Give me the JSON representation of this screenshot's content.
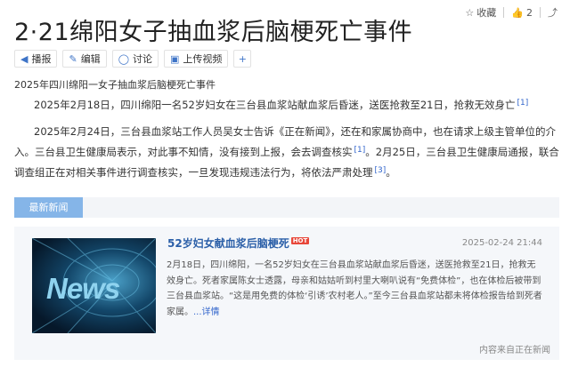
{
  "title": "2·21绵阳女子抽血浆后脑梗死亡事件",
  "top_actions": {
    "favorite_label": "收藏",
    "like_count": "2"
  },
  "toolbar": {
    "play_label": "播报",
    "edit_label": "编辑",
    "discuss_label": "讨论",
    "upload_video_label": "上传视频",
    "add_label": "+"
  },
  "summary": "2025年四川绵阳一女子抽血浆后脑梗死亡事件",
  "paragraph1": {
    "text": "2025年2月18日，四川绵阳一名52岁妇女在三台县血浆站献血浆后昏迷，送医抢救至21日，抢救无效身亡",
    "ref": "[1]"
  },
  "paragraph2": {
    "text_a": "2025年2月24日，三台县血浆站工作人员吴女士告诉《正在新闻》，还在和家属协商中，也在请求上级主管单位的介入。三台县卫生健康局表示，对此事不知情，没有接到上报，会去调查核实",
    "ref_a": "[1]",
    "text_b": "。2月25日，三台县卫生健康局通报，联合调查组正在对相关事件进行调查核实，一旦发现违规违法行为，将依法严肃处理",
    "ref_b": "[3]",
    "tail": "。"
  },
  "news": {
    "tab_label": "最新新闻",
    "thumb_text": "News",
    "headline": "52岁妇女献血浆后脑梗死",
    "hot_badge": "HOT",
    "datetime": "2025-02-24 21:44",
    "excerpt": "2月18日，四川绵阳，一名52岁妇女在三台县血浆站献血浆后昏迷，送医抢救至21日，抢救无效身亡。死者家属陈女士透露，母亲和姑姑听到村里大喇叭说有“免费体检”，也在体检后被带到三台县血浆站。“这是用免费的体检‘引诱’农村老人。”至今三台县血浆站都未将体检报告给到死者家属。",
    "more_label": "...详情",
    "source": "内容来自正在新闻"
  }
}
